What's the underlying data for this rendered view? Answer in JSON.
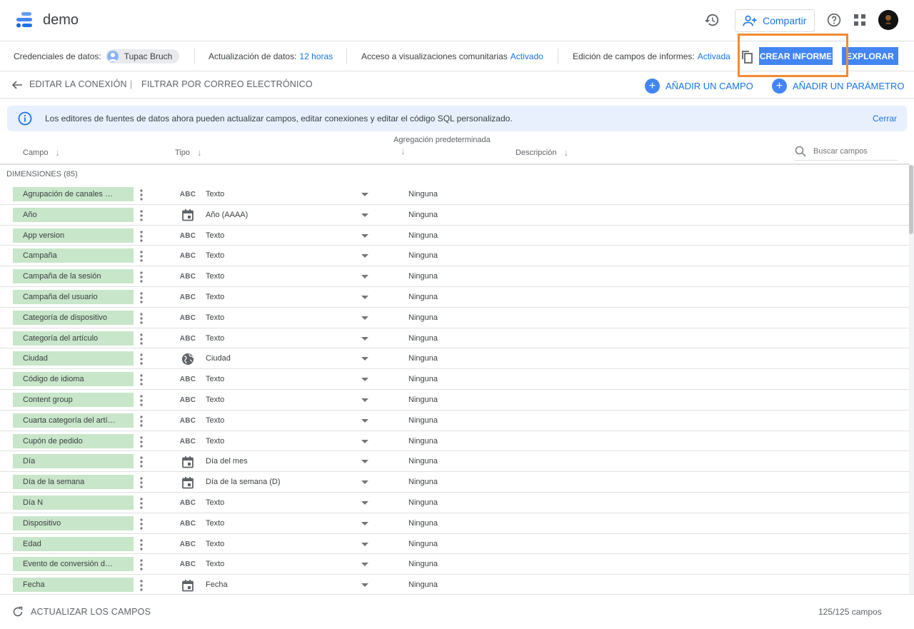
{
  "header": {
    "title": "demo",
    "share_label": "Compartir"
  },
  "infobar": {
    "credentials_label": "Credenciales de datos:",
    "credentials_user": "Tupac Bruch",
    "refresh_label": "Actualización de datos:",
    "refresh_value": "12 horas",
    "community_label": "Acceso a visualizaciones comunitarias",
    "community_value": "Activado",
    "editing_label": "Edición de campos de informes:",
    "editing_value": "Activada",
    "create_report_label": "CREAR INFORME",
    "explore_label": "EXPLORAR"
  },
  "actionbar": {
    "edit_connection": "EDITAR LA CONEXIÓN",
    "separator": "|",
    "filter_email": "FILTRAR POR CORREO ELECTRÓNICO",
    "add_field": "AÑADIR UN CAMPO",
    "add_parameter": "AÑADIR UN PARÁMETRO"
  },
  "notice": {
    "text": "Los editores de fuentes de datos ahora pueden actualizar campos, editar conexiones y editar el código SQL personalizado.",
    "close_label": "Cerrar"
  },
  "columns": {
    "field": "Campo",
    "type": "Tipo",
    "aggregation": "Agregación predeterminada",
    "description": "Descripción",
    "search_placeholder": "Buscar campos"
  },
  "section": {
    "label": "DIMENSIONES (85)"
  },
  "rows": [
    {
      "field": "Agrupación de canales pr...",
      "icon": "abc",
      "type": "Texto",
      "agg": "Ninguna"
    },
    {
      "field": "Año",
      "icon": "calendar",
      "type": "Año (AAAA)",
      "agg": "Ninguna"
    },
    {
      "field": "App version",
      "icon": "abc",
      "type": "Texto",
      "agg": "Ninguna"
    },
    {
      "field": "Campaña",
      "icon": "abc",
      "type": "Texto",
      "agg": "Ninguna"
    },
    {
      "field": "Campaña de la sesión",
      "icon": "abc",
      "type": "Texto",
      "agg": "Ninguna"
    },
    {
      "field": "Campaña del usuario",
      "icon": "abc",
      "type": "Texto",
      "agg": "Ninguna"
    },
    {
      "field": "Categoría de dispositivo",
      "icon": "abc",
      "type": "Texto",
      "agg": "Ninguna"
    },
    {
      "field": "Categoría del artículo",
      "icon": "abc",
      "type": "Texto",
      "agg": "Ninguna"
    },
    {
      "field": "Ciudad",
      "icon": "globe",
      "type": "Ciudad",
      "agg": "Ninguna"
    },
    {
      "field": "Código de idioma",
      "icon": "abc",
      "type": "Texto",
      "agg": "Ninguna"
    },
    {
      "field": "Content group",
      "icon": "abc",
      "type": "Texto",
      "agg": "Ninguna"
    },
    {
      "field": "Cuarta categoría del artíc...",
      "icon": "abc",
      "type": "Texto",
      "agg": "Ninguna"
    },
    {
      "field": "Cupón de pedido",
      "icon": "abc",
      "type": "Texto",
      "agg": "Ninguna"
    },
    {
      "field": "Día",
      "icon": "calendar",
      "type": "Día del mes",
      "agg": "Ninguna"
    },
    {
      "field": "Día de la semana",
      "icon": "calendar",
      "type": "Día de la semana (D)",
      "agg": "Ninguna"
    },
    {
      "field": "Día N",
      "icon": "abc",
      "type": "Texto",
      "agg": "Ninguna"
    },
    {
      "field": "Dispositivo",
      "icon": "abc",
      "type": "Texto",
      "agg": "Ninguna"
    },
    {
      "field": "Edad",
      "icon": "abc",
      "type": "Texto",
      "agg": "Ninguna"
    },
    {
      "field": "Evento de conversión de ...",
      "icon": "abc",
      "type": "Texto",
      "agg": "Ninguna"
    },
    {
      "field": "Fecha",
      "icon": "calendar",
      "type": "Fecha",
      "agg": "Ninguna"
    }
  ],
  "footer": {
    "refresh_label": "ACTUALIZAR LOS CAMPOS",
    "count": "125/125 campos"
  },
  "colors": {
    "accent": "#1a73e8",
    "button": "#4285f4",
    "chip": "#c8e6c9",
    "highlight": "#f28b34"
  }
}
